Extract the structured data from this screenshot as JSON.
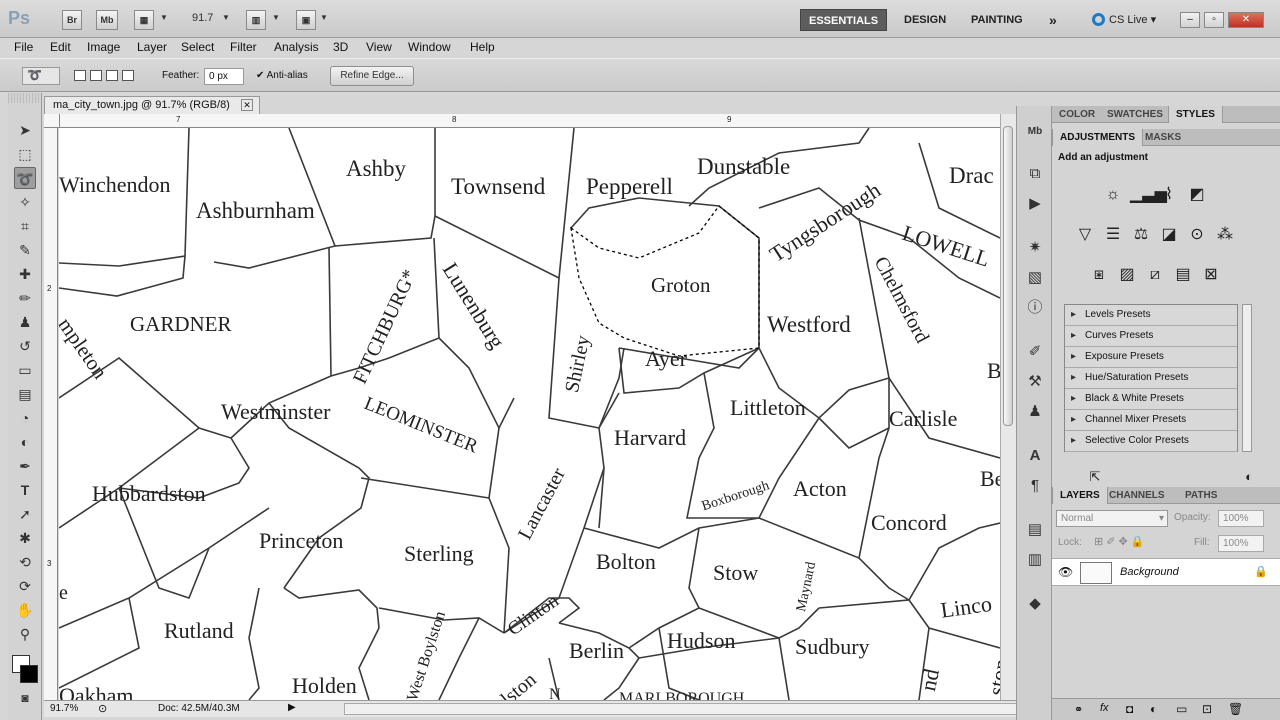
{
  "appbar": {
    "logo": "Ps",
    "bridge_label": "Br",
    "minibridge_label": "Mb",
    "zoom": "91.7",
    "workspaces": [
      "ESSENTIALS",
      "DESIGN",
      "PAINTING"
    ],
    "more_glyph": "»",
    "cslive": "CS Live"
  },
  "menu": [
    "File",
    "Edit",
    "Image",
    "Layer",
    "Select",
    "Filter",
    "Analysis",
    "3D",
    "View",
    "Window",
    "Help"
  ],
  "options": {
    "feather_label": "Feather:",
    "feather_value": "0 px",
    "antialias_label": "Anti-alias",
    "refine_label": "Refine Edge..."
  },
  "document": {
    "tab_title": "ma_city_town.jpg @ 91.7% (RGB/8)",
    "ruler_top": [
      "7",
      "8",
      "9"
    ],
    "ruler_left": [
      "2",
      "3"
    ],
    "status_zoom": "91.7%",
    "status_doc": "Doc: 42.5M/40.3M"
  },
  "towns": [
    "Winchendon",
    "Ashby",
    "Townsend",
    "Pepperell",
    "Dunstable",
    "Tyngsborough",
    "Drac",
    "Ashburnham",
    "Groton",
    "LOWELL",
    "FITCHBURG*",
    "Lunenburg",
    "Chelmsford",
    "GARDNER",
    "Shirley",
    "Westford",
    "mpleton",
    "Ayer",
    "Westminster",
    "LEOMINSTER",
    "Littleton",
    "Carlisle",
    "Harvard",
    "B",
    "Hubbardston",
    "Lancaster",
    "Boxborough",
    "Acton",
    "Concord",
    "Be",
    "Princeton",
    "Sterling",
    "Bolton",
    "Stow",
    "Maynard",
    "Rutland",
    "Clinton",
    "Berlin",
    "Hudson",
    "Sudbury",
    "Linco",
    "West Boylston",
    "ylston",
    "Holden",
    "Oakham",
    "MARLBOROUGH",
    "nd",
    "ston",
    "e",
    "N"
  ],
  "panels": {
    "top_tabs": [
      "COLOR",
      "SWATCHES",
      "STYLES"
    ],
    "adj_tabs": [
      "ADJUSTMENTS",
      "MASKS"
    ],
    "add_adjustment": "Add an adjustment",
    "presets": [
      "Levels Presets",
      "Curves Presets",
      "Exposure Presets",
      "Hue/Saturation Presets",
      "Black & White Presets",
      "Channel Mixer Presets",
      "Selective Color Presets"
    ],
    "layer_tabs": [
      "LAYERS",
      "CHANNELS",
      "PATHS"
    ],
    "blend_mode": "Normal",
    "opacity_label": "Opacity:",
    "opacity_value": "100%",
    "lock_label": "Lock:",
    "fill_label": "Fill:",
    "fill_value": "100%",
    "layer_name": "Background"
  }
}
